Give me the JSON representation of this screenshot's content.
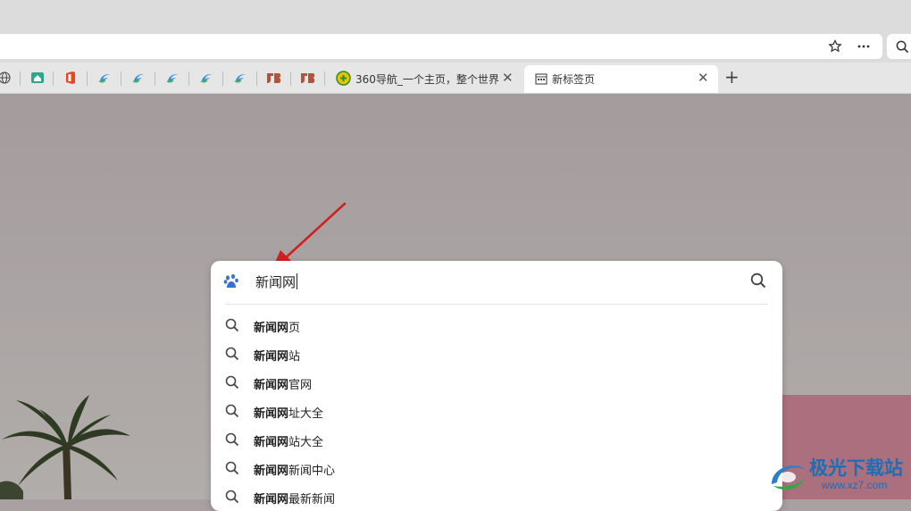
{
  "toolbar": {
    "icons": [
      "star-icon",
      "more-icon",
      "search-icon"
    ]
  },
  "tabs": {
    "inactive_tab_title": "360导航_一个主页，整个世界",
    "active_tab_title": "新标签页",
    "new_tab": "+"
  },
  "search": {
    "query": "新闻网",
    "engine_icon": "baidu-paw-icon",
    "suggestions": [
      {
        "bold": "新闻网",
        "rest": "页"
      },
      {
        "bold": "新闻网",
        "rest": "站"
      },
      {
        "bold": "新闻网",
        "rest": "官网"
      },
      {
        "bold": "新闻网",
        "rest": "址大全"
      },
      {
        "bold": "新闻网",
        "rest": "站大全"
      },
      {
        "bold": "新闻网",
        "rest": "新闻中心"
      },
      {
        "bold": "新闻网",
        "rest": "最新新闻"
      }
    ]
  },
  "watermark": {
    "name": "极光下载站",
    "url": "www.xz7.com"
  },
  "colors": {
    "accent_red_arrow": "#d0201f",
    "watermark_blue": "#1c6fb6",
    "background": "#a8a0a1"
  }
}
